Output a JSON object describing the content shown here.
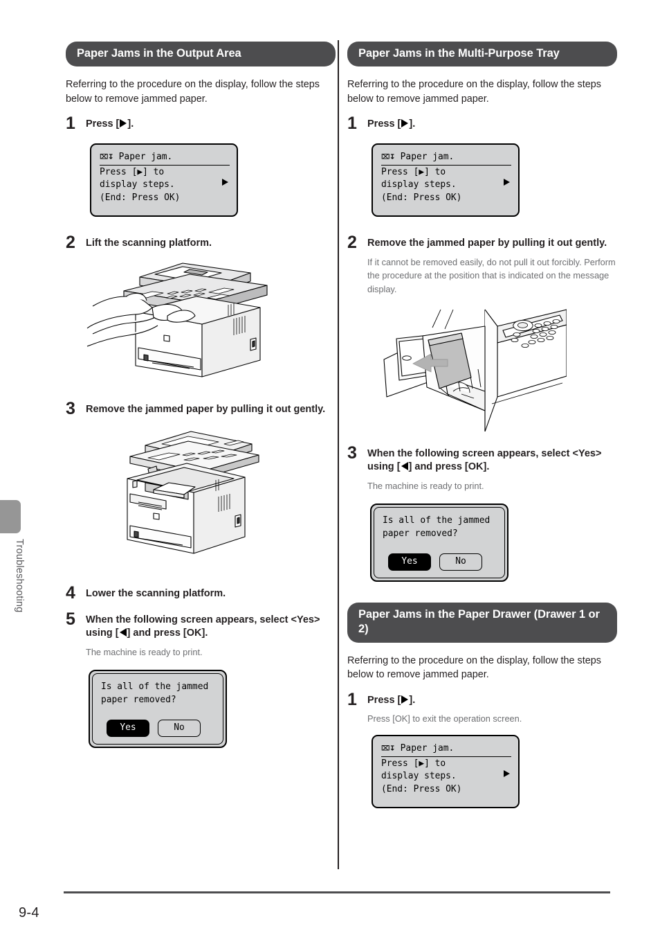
{
  "page": {
    "folio": "9-4",
    "side_tab_label": "Troubleshooting"
  },
  "icons": {
    "paper_jam": "⌇↓",
    "arrow_right": "right-triangle",
    "arrow_left": "left-triangle"
  },
  "sections": [
    {
      "id": "output-area",
      "title": "Paper Jams in the Output Area",
      "intro": "Referring to the procedure on the display, follow the steps below to remove jammed paper.",
      "steps": [
        {
          "num": "1",
          "title_before": "Press [",
          "title_after": "].",
          "arrow": "right",
          "lcd": {
            "title": "Paper jam.",
            "lines": [
              "Press [▶] to",
              "display steps.",
              "(End: Press OK)"
            ],
            "side_arrow": true
          }
        },
        {
          "num": "2",
          "title": "Lift the scanning platform.",
          "figure": "printer-lift-platform"
        },
        {
          "num": "3",
          "title": "Remove the jammed paper by pulling it out gently.",
          "figure": "printer-platform-open"
        },
        {
          "num": "4",
          "title": "Lower the scanning platform."
        },
        {
          "num": "5",
          "title_before": "When the following screen appears, select <Yes> using [",
          "title_after": "] and press [OK].",
          "arrow": "left",
          "note": "The machine is ready to print.",
          "dialog": {
            "lines": [
              "Is all of the jammed",
              "paper removed?"
            ],
            "yes_label": "Yes",
            "no_label": "No",
            "selected": "Yes"
          }
        }
      ]
    },
    {
      "id": "multi-purpose-tray",
      "title": "Paper Jams in the Multi-Purpose Tray",
      "intro": "Referring to the procedure on the display, follow the steps below to remove jammed paper.",
      "steps": [
        {
          "num": "1",
          "title_before": "Press [",
          "title_after": "].",
          "arrow": "right",
          "lcd": {
            "title": "Paper jam.",
            "lines": [
              "Press [▶] to",
              "display steps.",
              "(End: Press OK)"
            ],
            "side_arrow": true
          }
        },
        {
          "num": "2",
          "title": "Remove the jammed paper by pulling it out gently.",
          "note": "If it cannot be removed easily, do not pull it out forcibly. Perform the procedure at the position that is indicated on the message display.",
          "figure": "mp-tray-pull-paper"
        },
        {
          "num": "3",
          "title_before": "When the following screen appears, select <Yes> using [",
          "title_after": "] and press [OK].",
          "arrow": "left",
          "note": "The machine is ready to print.",
          "dialog": {
            "lines": [
              "Is all of the jammed",
              "paper removed?"
            ],
            "yes_label": "Yes",
            "no_label": "No",
            "selected": "Yes"
          }
        }
      ]
    },
    {
      "id": "paper-drawer",
      "title": "Paper Jams in the Paper Drawer (Drawer 1 or 2)",
      "intro": "Referring to the procedure on the display, follow the steps below to remove jammed paper.",
      "steps": [
        {
          "num": "1",
          "title_before": "Press [",
          "title_after": "].",
          "arrow": "right",
          "note": "Press [OK] to exit the operation screen.",
          "lcd": {
            "title": "Paper jam.",
            "lines": [
              "Press [▶] to",
              "display steps.",
              "(End: Press OK)"
            ],
            "side_arrow": true
          }
        }
      ]
    }
  ],
  "colors": {
    "header_bar": "#4d4d4f",
    "lcd_background": "#d2d3d4",
    "note_text": "#6d6e71",
    "side_tab": "#969696"
  }
}
